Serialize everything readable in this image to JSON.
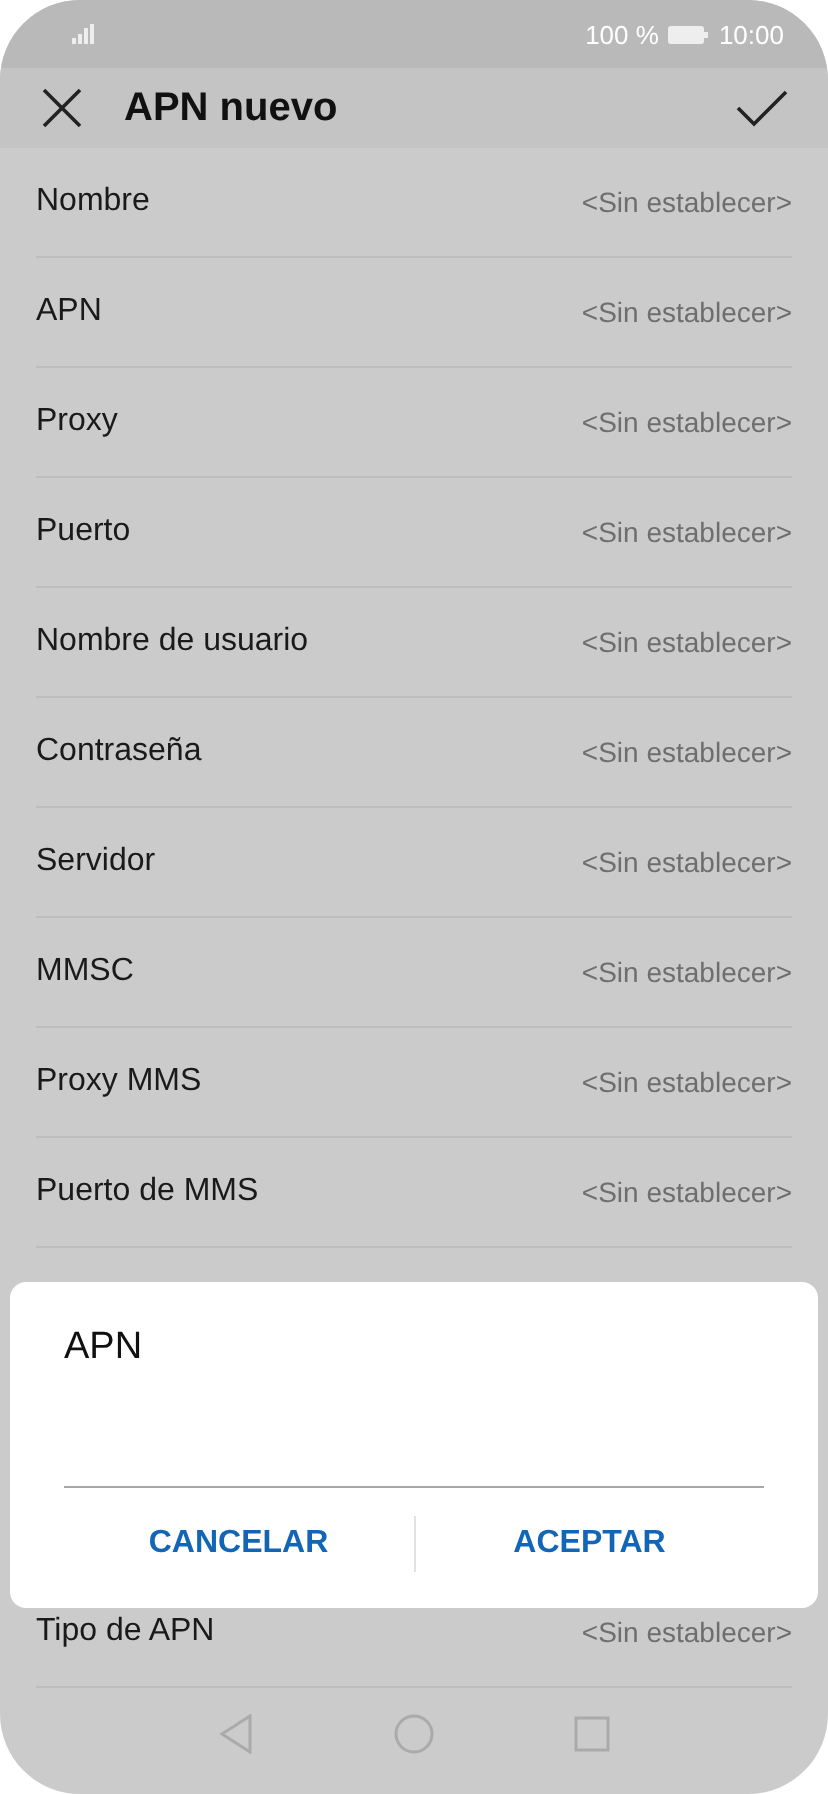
{
  "status_bar": {
    "battery": "100 %",
    "time": "10:00"
  },
  "header": {
    "title": "APN nuevo"
  },
  "settings": [
    {
      "label": "Nombre",
      "value": "<Sin establecer>"
    },
    {
      "label": "APN",
      "value": "<Sin establecer>"
    },
    {
      "label": "Proxy",
      "value": "<Sin establecer>"
    },
    {
      "label": "Puerto",
      "value": "<Sin establecer>"
    },
    {
      "label": "Nombre de usuario",
      "value": "<Sin establecer>"
    },
    {
      "label": "Contraseña",
      "value": "<Sin establecer>"
    },
    {
      "label": "Servidor",
      "value": "<Sin establecer>"
    },
    {
      "label": "MMSC",
      "value": "<Sin establecer>"
    },
    {
      "label": "Proxy MMS",
      "value": "<Sin establecer>"
    },
    {
      "label": "Puerto de MMS",
      "value": "<Sin establecer>"
    }
  ],
  "settings_below_dialog": [
    {
      "label": "Tipo de APN",
      "value": "<Sin establecer>"
    }
  ],
  "dialog": {
    "title": "APN",
    "buttons": [
      "CANCELAR",
      "ACEPTAR"
    ]
  }
}
